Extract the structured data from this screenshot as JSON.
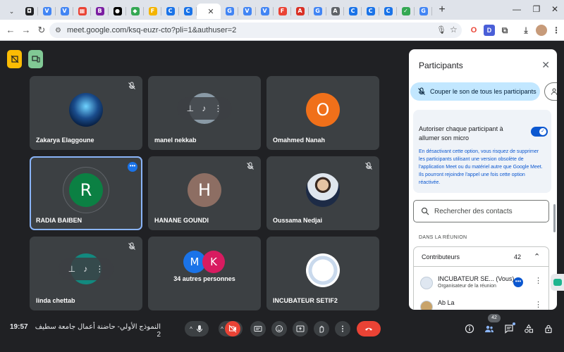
{
  "browser": {
    "tabs": [
      {
        "glyph": "◘",
        "color": "#202124"
      },
      {
        "glyph": "V",
        "color": "#4285f4"
      },
      {
        "glyph": "V",
        "color": "#4285f4"
      },
      {
        "glyph": "▦",
        "color": "#ea4335"
      },
      {
        "glyph": "B",
        "color": "#7b1fa2"
      },
      {
        "glyph": "●",
        "color": "#000000"
      },
      {
        "glyph": "◆",
        "color": "#34a853"
      },
      {
        "glyph": "F",
        "color": "#f4b400"
      },
      {
        "glyph": "C",
        "color": "#1a73e8"
      },
      {
        "glyph": "C",
        "color": "#1a73e8"
      },
      {
        "glyph": "",
        "color": "#ffffff",
        "active": true
      },
      {
        "glyph": "G",
        "color": "#4285f4"
      },
      {
        "glyph": "V",
        "color": "#4285f4"
      },
      {
        "glyph": "V",
        "color": "#4285f4"
      },
      {
        "glyph": "F",
        "color": "#ea4335"
      },
      {
        "glyph": "A",
        "color": "#d93025"
      },
      {
        "glyph": "G",
        "color": "#4285f4"
      },
      {
        "glyph": "A",
        "color": "#5f6368"
      },
      {
        "glyph": "C",
        "color": "#1a73e8"
      },
      {
        "glyph": "C",
        "color": "#1a73e8"
      },
      {
        "glyph": "C",
        "color": "#1a73e8"
      },
      {
        "glyph": "✓",
        "color": "#34a853"
      },
      {
        "glyph": "G",
        "color": "#4285f4"
      }
    ],
    "new_tab": "+",
    "url": "meet.google.com/ksq-euzr-cto?pli=1&authuser=2"
  },
  "tiles": [
    {
      "name": "Zakarya Elaggoune",
      "muted": true,
      "avatar": "iceberg"
    },
    {
      "name": "manel nekkab",
      "muted": false,
      "avatar": "hover"
    },
    {
      "name": "Omahmed Nanah",
      "muted": false,
      "avatar": "letter",
      "letter": "O",
      "color": "#f0701a"
    },
    {
      "name": "RADIA BAIBEN",
      "muted": false,
      "avatar": "letter",
      "letter": "R",
      "color": "#0b8043",
      "selected": true
    },
    {
      "name": "HANANE GOUNDI",
      "muted": true,
      "avatar": "letter",
      "letter": "H",
      "color": "#8d6e63"
    },
    {
      "name": "Oussama Nedjai",
      "muted": true,
      "avatar": "photo"
    },
    {
      "name": "linda chettab",
      "muted": true,
      "avatar": "hover-teal"
    },
    {
      "name": "34 autres personnes",
      "muted": false,
      "avatar": "group",
      "letters": [
        "M",
        "K"
      ]
    },
    {
      "name": "INCUBATEUR SETIF2",
      "muted": false,
      "avatar": "logo"
    }
  ],
  "bottom": {
    "time": "19:57",
    "meeting_name": "النموذج الأولي- حاضنة أعمال جامعة سطيف 2",
    "participant_count": "42"
  },
  "panel": {
    "title": "Participants",
    "mute_all": "Couper le son de tous les participants",
    "allow_label": "Autoriser chaque participant à allumer son micro",
    "allow_note": "En désactivant cette option, vous risquez de supprimer les participants utilisant une version obsolète de l'application Meet ou du matériel autre que Google Meet. Ils pourront rejoindre l'appel une fois cette option réactivée.",
    "search_placeholder": "Rechercher des contacts",
    "section": "DANS LA RÉUNION",
    "group_title": "Contributeurs",
    "group_count": "42",
    "participants": [
      {
        "name": "INCUBATEUR SE... (Vous)",
        "role": "Organisateur de la réunion"
      },
      {
        "name": "Ab La",
        "role": ""
      }
    ]
  }
}
